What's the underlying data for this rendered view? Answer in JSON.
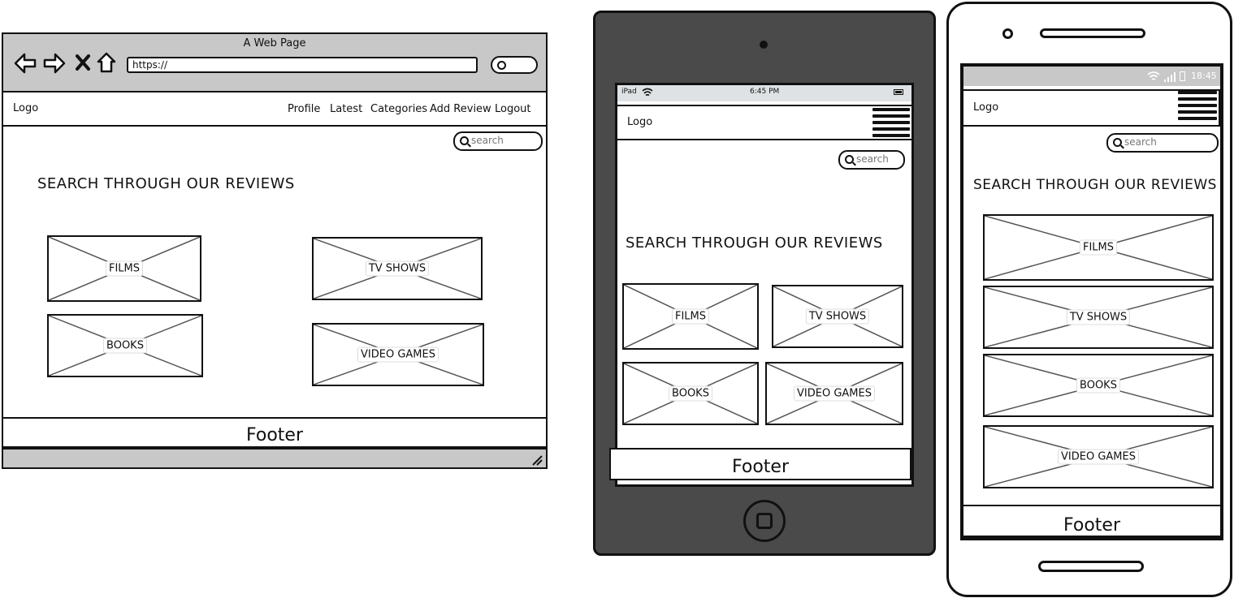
{
  "desktop": {
    "window_title": "A Web Page",
    "url": "https://",
    "logo": "Logo",
    "nav": [
      "Profile",
      "Latest",
      "Categories",
      "Add Review",
      "Logout"
    ],
    "search_placeholder": "search",
    "heading": "SEARCH THROUGH OUR REVIEWS",
    "categories": [
      "FILMS",
      "TV SHOWS",
      "BOOKS",
      "VIDEO GAMES"
    ],
    "footer": "Footer"
  },
  "tablet": {
    "status_carrier": "iPad",
    "status_time": "6:45 PM",
    "logo": "Logo",
    "search_placeholder": "search",
    "heading": "SEARCH THROUGH OUR REVIEWS",
    "categories": [
      "FILMS",
      "TV SHOWS",
      "BOOKS",
      "VIDEO GAMES"
    ],
    "footer": "Footer"
  },
  "phone": {
    "status_time": "18:45",
    "logo": "Logo",
    "search_placeholder": "search",
    "heading": "SEARCH THROUGH OUR REVIEWS",
    "categories": [
      "FILMS",
      "TV SHOWS",
      "BOOKS",
      "VIDEO GAMES"
    ],
    "footer": "Footer"
  },
  "icons": {
    "back": "back-arrow-icon",
    "forward": "forward-arrow-icon",
    "close": "close-icon",
    "home": "home-icon",
    "search": "search-icon",
    "resize": "resize-grip-icon",
    "wifi": "wifi-icon",
    "battery": "battery-icon",
    "signal": "signal-icon",
    "camera": "camera-icon",
    "home_button": "home-button-icon",
    "menu": "hamburger-menu-icon"
  },
  "colors": {
    "browser_chrome": "#c8c8c8",
    "tablet_body": "#4a4a4a",
    "placeholder_cross": "#555555"
  }
}
